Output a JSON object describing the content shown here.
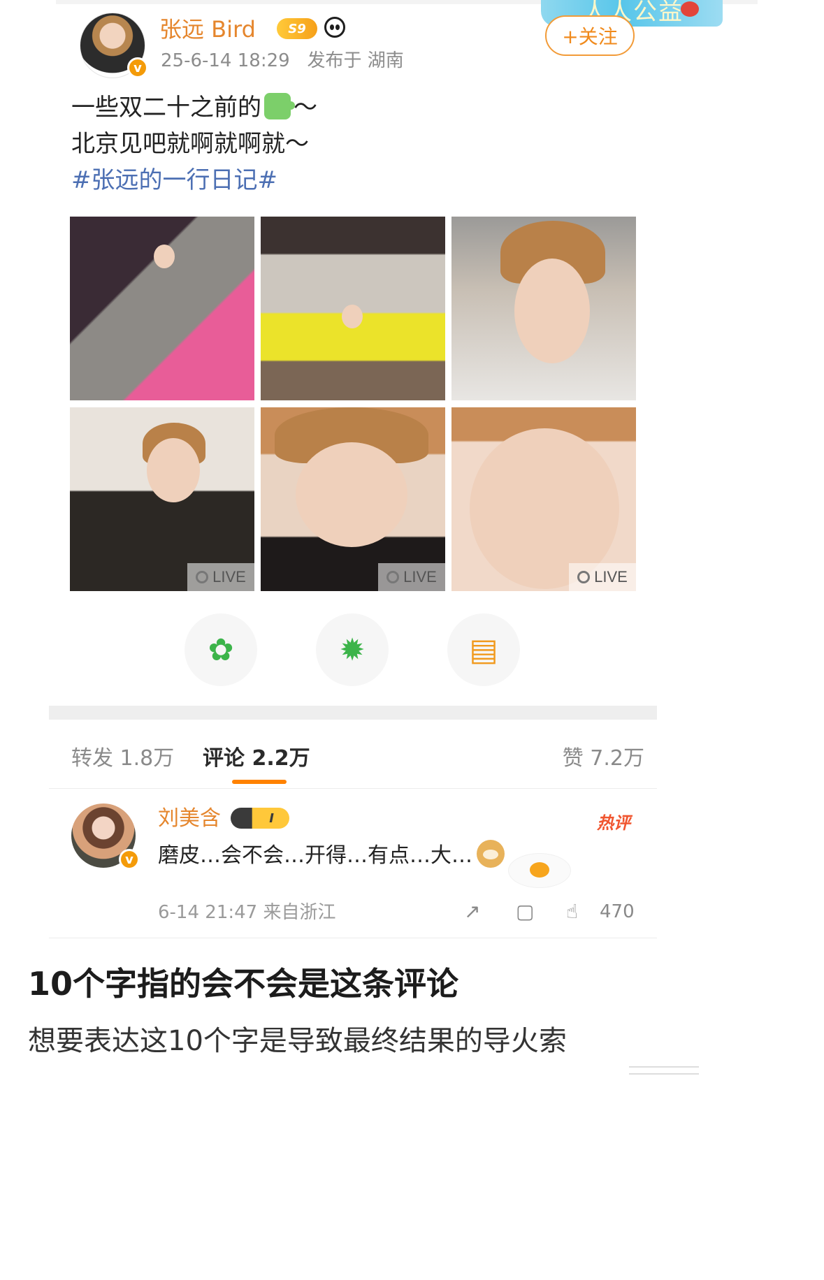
{
  "post": {
    "username": "张远 Bird",
    "level_badge": "S9",
    "timestamp": "25-6-14 18:29",
    "location": "发布于 湖南",
    "follow_label": "+关注",
    "banner_text": "人人公益",
    "text_line1_prefix": "一些双二十之前的",
    "text_line1_suffix": "～",
    "text_line2": "北京见吧就啊就啊就～",
    "hashtag": "#张远的一行日记#",
    "live_label": "LIVE"
  },
  "tabs": {
    "repost": "转发 1.8万",
    "comment": "评论 2.2万",
    "like": "赞 7.2万"
  },
  "comment": {
    "username": "刘美含",
    "badge": "I",
    "hot_label": "热评",
    "text": "磨皮…会不会…开得…有点…大…",
    "meta": "6-14 21:47 来自浙江",
    "like_count": "470"
  },
  "overlay": {
    "title": "10个字指的会不会是这条评论",
    "subtitle": "想要表达这10个字是导致最终结果的导火索"
  },
  "icons": {
    "share_wechat": "wechat-icon",
    "share_moments": "moments-icon",
    "save_image": "save-image-icon"
  },
  "colors": {
    "accent_orange": "#ff8200",
    "username_orange": "#e5862d",
    "hashtag_blue": "#4c6fb3"
  }
}
